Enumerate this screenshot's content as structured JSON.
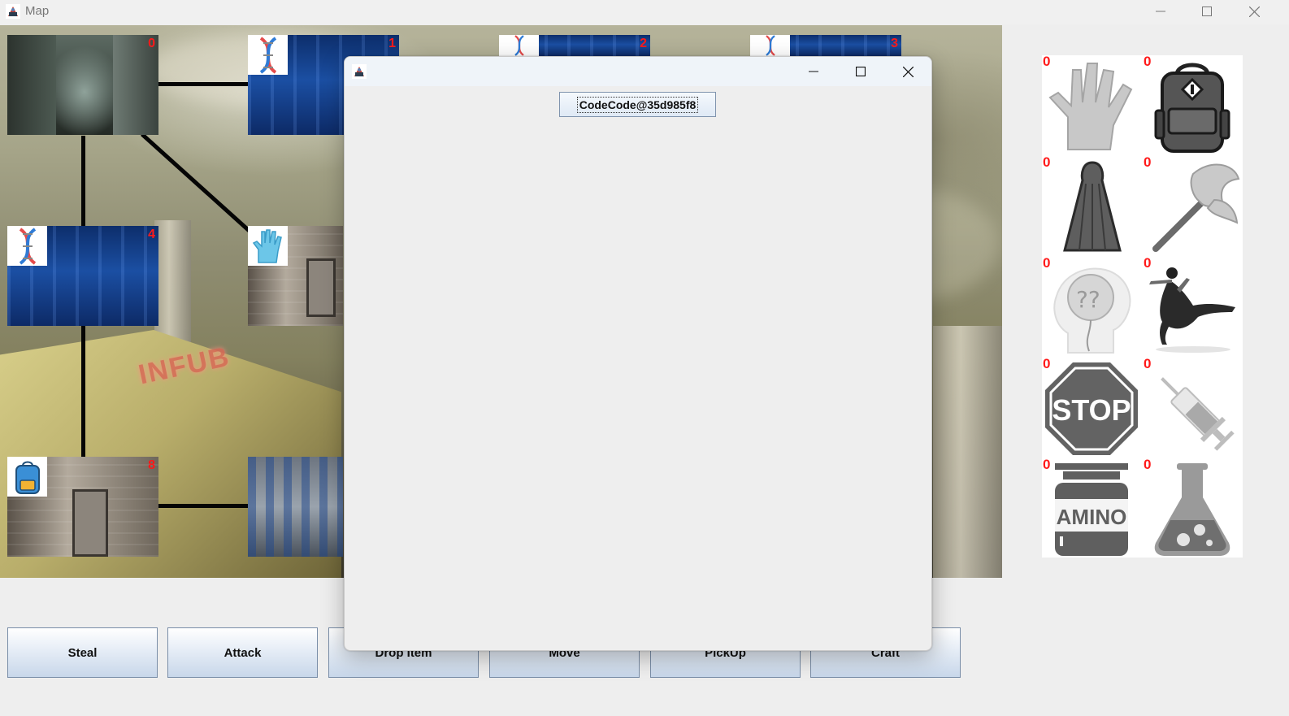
{
  "window": {
    "title": "Map",
    "icon": "java-app-icon",
    "controls": [
      "minimize-icon",
      "maximize-icon",
      "close-icon"
    ]
  },
  "map": {
    "rooms": [
      {
        "number": "0",
        "scene": "ruined-alley",
        "item_icon": null
      },
      {
        "number": "1",
        "scene": "blue-lab",
        "item_icon": "dna-icon"
      },
      {
        "number": "2",
        "scene": "blue-lab",
        "item_icon": "dna-icon"
      },
      {
        "number": "3",
        "scene": "blue-lab",
        "item_icon": "dna-icon"
      },
      {
        "number": "4",
        "scene": "blue-lab",
        "item_icon": "dna-icon"
      },
      {
        "number": "",
        "scene": "bunker-door",
        "item_icon": "glove-icon"
      },
      {
        "number": "8",
        "scene": "bunker-door",
        "item_icon": "backpack-icon"
      },
      {
        "number": "",
        "scene": "warehouse",
        "item_icon": null
      }
    ],
    "signage_text": "INFUB"
  },
  "inventory": {
    "items": [
      {
        "name": "glove",
        "count": "0",
        "icon": "glove-icon"
      },
      {
        "name": "backpack",
        "count": "0",
        "icon": "backpack-icon"
      },
      {
        "name": "cloak",
        "count": "0",
        "icon": "cloak-icon"
      },
      {
        "name": "axe",
        "count": "0",
        "icon": "axe-icon"
      },
      {
        "name": "forget",
        "count": "0",
        "icon": "confused-head-icon"
      },
      {
        "name": "dance",
        "count": "0",
        "icon": "dancer-icon"
      },
      {
        "name": "stop",
        "count": "0",
        "icon": "stop-sign-icon",
        "label": "STOP"
      },
      {
        "name": "syringe",
        "count": "0",
        "icon": "syringe-icon"
      },
      {
        "name": "amino",
        "count": "0",
        "icon": "amino-jar-icon",
        "label": "AMINO"
      },
      {
        "name": "flask",
        "count": "0",
        "icon": "flask-icon"
      }
    ]
  },
  "actions": {
    "steal": "Steal",
    "attack": "Attack",
    "drop_item": "Drop Item",
    "move": "Move",
    "pickup": "PickUp",
    "craft": "Craft"
  },
  "dialog": {
    "title": "",
    "code_button": "CodeCode@35d985f8"
  },
  "colors": {
    "count_red": "#ff1a1a",
    "button_blue": "#c8d7ea",
    "connector": "#050505"
  }
}
